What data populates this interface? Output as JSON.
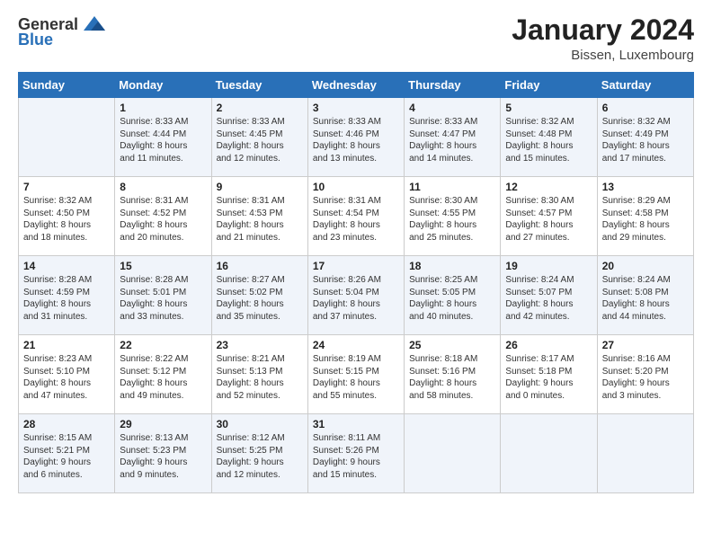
{
  "logo": {
    "general": "General",
    "blue": "Blue"
  },
  "title": "January 2024",
  "location": "Bissen, Luxembourg",
  "days_of_week": [
    "Sunday",
    "Monday",
    "Tuesday",
    "Wednesday",
    "Thursday",
    "Friday",
    "Saturday"
  ],
  "weeks": [
    [
      {
        "day": "",
        "info": ""
      },
      {
        "day": "1",
        "info": "Sunrise: 8:33 AM\nSunset: 4:44 PM\nDaylight: 8 hours\nand 11 minutes."
      },
      {
        "day": "2",
        "info": "Sunrise: 8:33 AM\nSunset: 4:45 PM\nDaylight: 8 hours\nand 12 minutes."
      },
      {
        "day": "3",
        "info": "Sunrise: 8:33 AM\nSunset: 4:46 PM\nDaylight: 8 hours\nand 13 minutes."
      },
      {
        "day": "4",
        "info": "Sunrise: 8:33 AM\nSunset: 4:47 PM\nDaylight: 8 hours\nand 14 minutes."
      },
      {
        "day": "5",
        "info": "Sunrise: 8:32 AM\nSunset: 4:48 PM\nDaylight: 8 hours\nand 15 minutes."
      },
      {
        "day": "6",
        "info": "Sunrise: 8:32 AM\nSunset: 4:49 PM\nDaylight: 8 hours\nand 17 minutes."
      }
    ],
    [
      {
        "day": "7",
        "info": ""
      },
      {
        "day": "8",
        "info": "Sunrise: 8:31 AM\nSunset: 4:52 PM\nDaylight: 8 hours\nand 20 minutes."
      },
      {
        "day": "9",
        "info": "Sunrise: 8:31 AM\nSunset: 4:53 PM\nDaylight: 8 hours\nand 21 minutes."
      },
      {
        "day": "10",
        "info": "Sunrise: 8:31 AM\nSunset: 4:54 PM\nDaylight: 8 hours\nand 23 minutes."
      },
      {
        "day": "11",
        "info": "Sunrise: 8:30 AM\nSunset: 4:55 PM\nDaylight: 8 hours\nand 25 minutes."
      },
      {
        "day": "12",
        "info": "Sunrise: 8:30 AM\nSunset: 4:57 PM\nDaylight: 8 hours\nand 27 minutes."
      },
      {
        "day": "13",
        "info": "Sunrise: 8:29 AM\nSunset: 4:58 PM\nDaylight: 8 hours\nand 29 minutes."
      }
    ],
    [
      {
        "day": "14",
        "info": ""
      },
      {
        "day": "15",
        "info": "Sunrise: 8:28 AM\nSunset: 5:01 PM\nDaylight: 8 hours\nand 33 minutes."
      },
      {
        "day": "16",
        "info": "Sunrise: 8:27 AM\nSunset: 5:02 PM\nDaylight: 8 hours\nand 35 minutes."
      },
      {
        "day": "17",
        "info": "Sunrise: 8:26 AM\nSunset: 5:04 PM\nDaylight: 8 hours\nand 37 minutes."
      },
      {
        "day": "18",
        "info": "Sunrise: 8:25 AM\nSunset: 5:05 PM\nDaylight: 8 hours\nand 40 minutes."
      },
      {
        "day": "19",
        "info": "Sunrise: 8:24 AM\nSunset: 5:07 PM\nDaylight: 8 hours\nand 42 minutes."
      },
      {
        "day": "20",
        "info": "Sunrise: 8:24 AM\nSunset: 5:08 PM\nDaylight: 8 hours\nand 44 minutes."
      }
    ],
    [
      {
        "day": "21",
        "info": ""
      },
      {
        "day": "22",
        "info": "Sunrise: 8:22 AM\nSunset: 5:12 PM\nDaylight: 8 hours\nand 49 minutes."
      },
      {
        "day": "23",
        "info": "Sunrise: 8:21 AM\nSunset: 5:13 PM\nDaylight: 8 hours\nand 52 minutes."
      },
      {
        "day": "24",
        "info": "Sunrise: 8:19 AM\nSunset: 5:15 PM\nDaylight: 8 hours\nand 55 minutes."
      },
      {
        "day": "25",
        "info": "Sunrise: 8:18 AM\nSunset: 5:16 PM\nDaylight: 8 hours\nand 58 minutes."
      },
      {
        "day": "26",
        "info": "Sunrise: 8:17 AM\nSunset: 5:18 PM\nDaylight: 9 hours\nand 0 minutes."
      },
      {
        "day": "27",
        "info": "Sunrise: 8:16 AM\nSunset: 5:20 PM\nDaylight: 9 hours\nand 3 minutes."
      }
    ],
    [
      {
        "day": "28",
        "info": ""
      },
      {
        "day": "29",
        "info": "Sunrise: 8:13 AM\nSunset: 5:23 PM\nDaylight: 9 hours\nand 9 minutes."
      },
      {
        "day": "30",
        "info": "Sunrise: 8:12 AM\nSunset: 5:25 PM\nDaylight: 9 hours\nand 12 minutes."
      },
      {
        "day": "31",
        "info": "Sunrise: 8:11 AM\nSunset: 5:26 PM\nDaylight: 9 hours\nand 15 minutes."
      },
      {
        "day": "",
        "info": ""
      },
      {
        "day": "",
        "info": ""
      },
      {
        "day": "",
        "info": ""
      }
    ]
  ],
  "week1_sunday_info": "Sunrise: 8:32 AM\nSunset: 4:50 PM\nDaylight: 8 hours\nand 18 minutes.",
  "week2_sunday_info": "Sunrise: 8:32 AM\nSunset: 4:50 PM\nDaylight: 8 hours\nand 18 minutes.",
  "week3_sunday_info": "Sunrise: 8:28 AM\nSunset: 4:59 PM\nDaylight: 8 hours\nand 31 minutes.",
  "week4_sunday_info": "Sunrise: 8:23 AM\nSunset: 5:10 PM\nDaylight: 8 hours\nand 47 minutes.",
  "week5_sunday_info": "Sunrise: 8:15 AM\nSunset: 5:21 PM\nDaylight: 9 hours\nand 6 minutes."
}
